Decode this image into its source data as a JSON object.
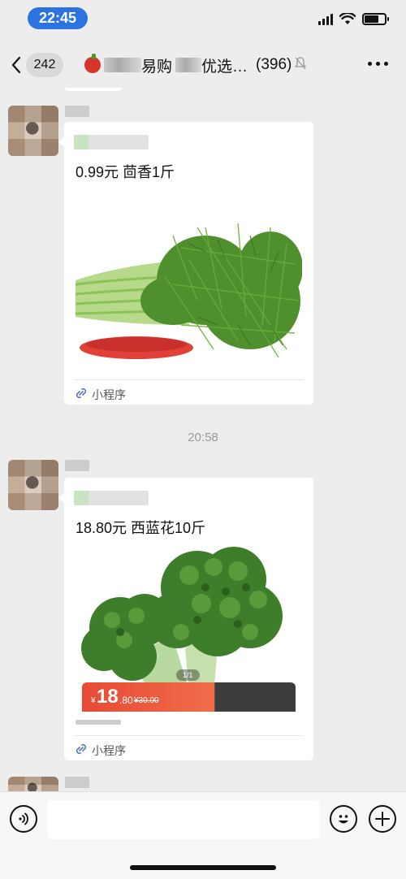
{
  "status_bar": {
    "time": "22:45"
  },
  "header": {
    "unread_count": "242",
    "title_part_1": "易购",
    "title_part_2": "优选…",
    "member_count": "(396)"
  },
  "messages": [
    {
      "title": "0.99元 茴香1斤",
      "mini_program_label": "小程序"
    },
    {
      "title": "18.80元 西蓝花10斤",
      "price_currency": "¥",
      "price_integer": "18",
      "price_decimal": ".80",
      "price_original": "¥30.00",
      "image_page": "1/1",
      "mini_program_label": "小程序"
    }
  ],
  "timestamp": "20:58",
  "input": {
    "value": ""
  },
  "colors": {
    "background": "#ededed",
    "time_pill": "#2a73e0",
    "price_banner": "#e64a35",
    "mini_program_icon": "#5a74c9"
  },
  "icons": {
    "back": "chevron-left-icon",
    "mute": "bell-slash-icon",
    "more": "more-dots-icon",
    "voice": "voice-icon",
    "emoji": "emoji-icon",
    "add": "plus-icon",
    "mini_program": "link-icon"
  }
}
